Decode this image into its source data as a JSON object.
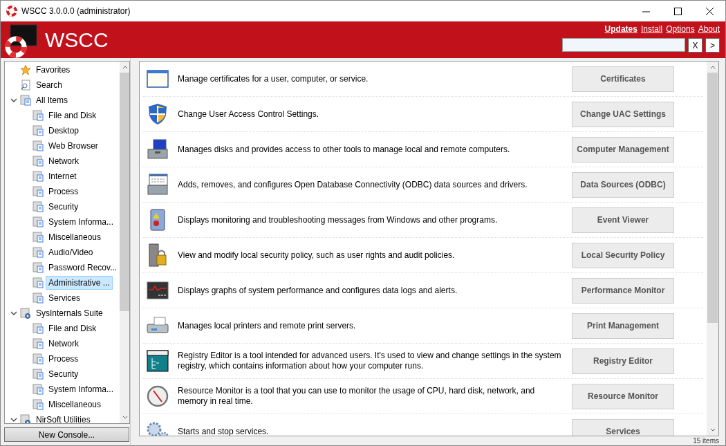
{
  "window": {
    "title": "WSCC 3.0.0.0 (administrator)"
  },
  "header": {
    "title": "WSCC",
    "links": [
      {
        "label": "Updates",
        "highlighted": true
      },
      {
        "label": "Install",
        "highlighted": false
      },
      {
        "label": "Options",
        "highlighted": false
      },
      {
        "label": "About",
        "highlighted": false
      }
    ],
    "clear_button": "X",
    "go_button": ">"
  },
  "sidebar": {
    "tree": [
      {
        "label": "Favorites",
        "kind": "star",
        "selected": false
      },
      {
        "label": "Search",
        "kind": "search",
        "selected": false
      },
      {
        "label": "All Items",
        "kind": "folder",
        "selected": false,
        "expanded": true,
        "children": [
          {
            "label": "File and Disk",
            "kind": "folder",
            "selected": false
          },
          {
            "label": "Desktop",
            "kind": "folder",
            "selected": false
          },
          {
            "label": "Web Browser",
            "kind": "folder",
            "selected": false
          },
          {
            "label": "Network",
            "kind": "folder",
            "selected": false
          },
          {
            "label": "Internet",
            "kind": "folder",
            "selected": false
          },
          {
            "label": "Process",
            "kind": "folder",
            "selected": false
          },
          {
            "label": "Security",
            "kind": "folder",
            "selected": false
          },
          {
            "label": "System Informa...",
            "kind": "folder",
            "selected": false
          },
          {
            "label": "Miscellaneous",
            "kind": "folder",
            "selected": false
          },
          {
            "label": "Audio/Video",
            "kind": "folder",
            "selected": false
          },
          {
            "label": "Password Recov...",
            "kind": "folder",
            "selected": false
          },
          {
            "label": "Administrative ...",
            "kind": "folder",
            "selected": true
          },
          {
            "label": "Services",
            "kind": "folder",
            "selected": false
          }
        ]
      },
      {
        "label": "SysInternals Suite",
        "kind": "suite",
        "selected": false,
        "expanded": true,
        "children": [
          {
            "label": "File and Disk",
            "kind": "folder",
            "selected": false
          },
          {
            "label": "Network",
            "kind": "folder",
            "selected": false
          },
          {
            "label": "Process",
            "kind": "folder",
            "selected": false
          },
          {
            "label": "Security",
            "kind": "folder",
            "selected": false
          },
          {
            "label": "System Informa...",
            "kind": "folder",
            "selected": false
          },
          {
            "label": "Miscellaneous",
            "kind": "folder",
            "selected": false
          }
        ]
      },
      {
        "label": "NirSoft Utilities",
        "kind": "suite",
        "selected": false,
        "expanded": true
      }
    ],
    "new_console_button": "New Console..."
  },
  "tools": [
    {
      "kind": "window",
      "description": "Manage certificates for a user, computer, or service.",
      "button": "Certificates"
    },
    {
      "kind": "shield",
      "description": "Change User Access Control Settings.",
      "button": "Change UAC Settings"
    },
    {
      "kind": "toolbox-monitor",
      "description": "Manages disks and provides access to other tools to manage local and remote computers.",
      "button": "Computer Management"
    },
    {
      "kind": "toolbox-table",
      "description": "Adds, removes, and configures Open Database Connectivity (ODBC) data sources and drivers.",
      "button": "Data Sources (ODBC)"
    },
    {
      "kind": "log",
      "description": "Displays monitoring and troubleshooting messages from Windows and other programs.",
      "button": "Event Viewer"
    },
    {
      "kind": "server-lock",
      "description": "View and modify local security policy, such as user rights and audit policies.",
      "button": "Local Security Policy"
    },
    {
      "kind": "graph",
      "description": "Displays graphs of system performance and configures data logs and alerts.",
      "button": "Performance Monitor"
    },
    {
      "kind": "printer",
      "description": "Manages local printers and remote print servers.",
      "button": "Print Management"
    },
    {
      "kind": "registry",
      "description": "Registry Editor is a tool intended for advanced users. It's used to view and change settings in the system registry, which contains information about how your computer runs.",
      "button": "Registry Editor"
    },
    {
      "kind": "gauge",
      "description": "Resource Monitor is a tool that you can use to monitor the usage of CPU, hard disk, network, and memory in real time.",
      "button": "Resource Monitor"
    },
    {
      "kind": "gears",
      "description": "Starts and stop services.",
      "button": "Services"
    }
  ],
  "status_bar": {
    "count": "15 items"
  }
}
